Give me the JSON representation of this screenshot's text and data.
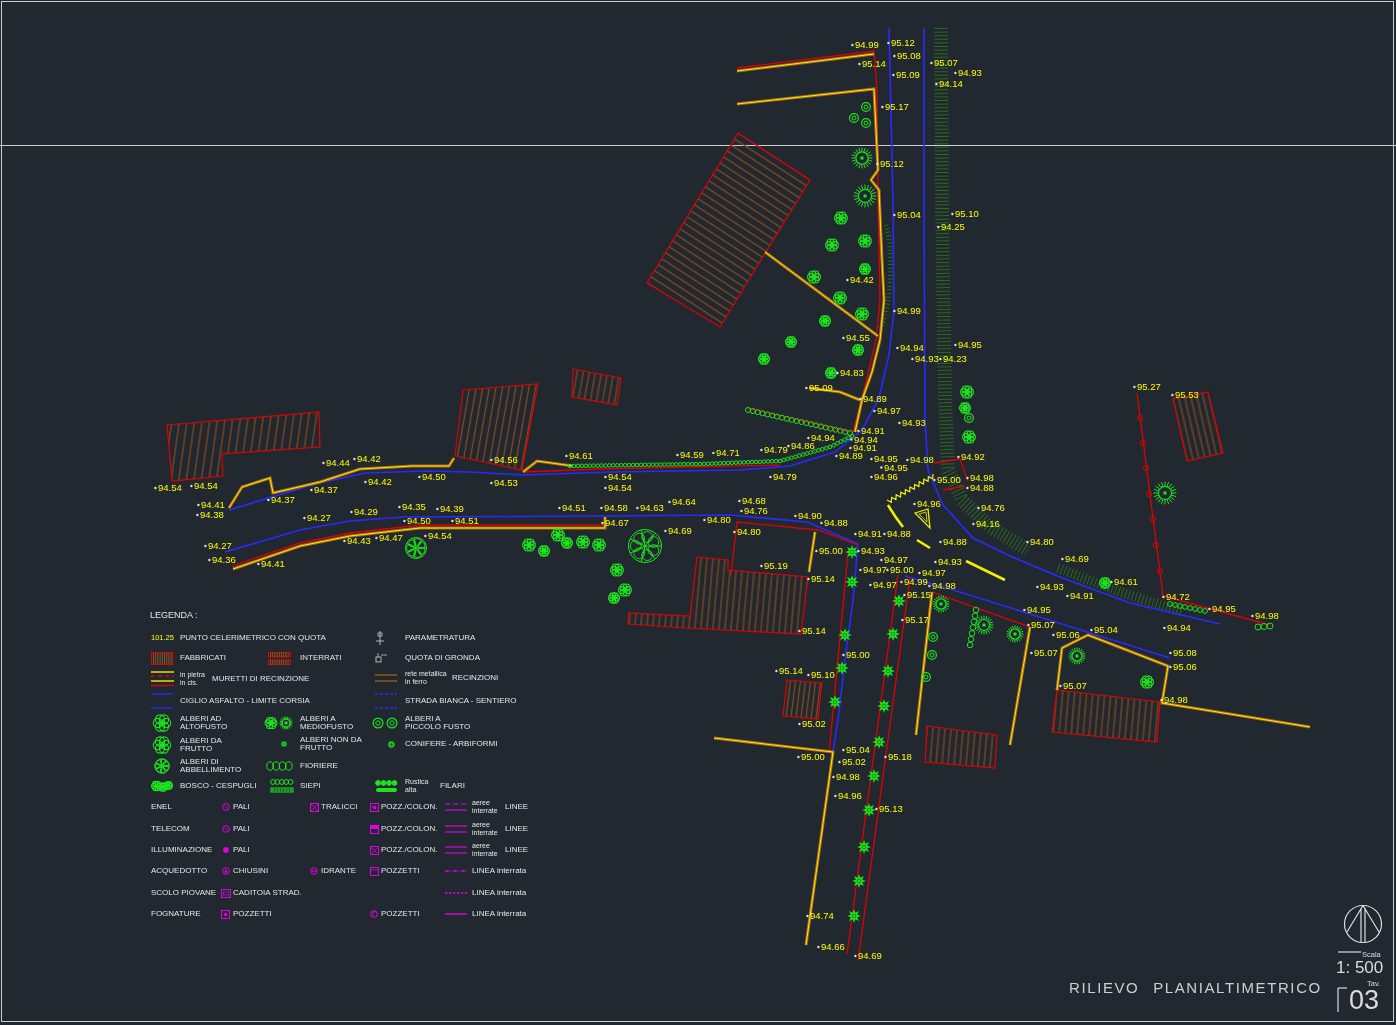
{
  "drawing": {
    "spot_heights": [
      "94.99",
      "95.12",
      "95.08",
      "95.14",
      "95.09",
      "95.07",
      "94.93",
      "94.14",
      "95.17",
      "95.12",
      "95.04",
      "95.10",
      "94.25",
      "94.42",
      "94.99",
      "94.55",
      "94.94",
      "94.95",
      "94.93",
      "94.23",
      "94.83",
      "95.09",
      "94.89",
      "94.97",
      "94.93",
      "94.91",
      "94.94",
      "94.94",
      "94.79",
      "94.86",
      "94.91",
      "94.89",
      "94.95",
      "94.98",
      "94.92",
      "94.95",
      "94.79",
      "94.96",
      "95.00",
      "94.98",
      "94.88",
      "94.96",
      "94.76",
      "94.16",
      "94.88",
      "94.80",
      "94.54",
      "94.54",
      "94.44",
      "94.42",
      "94.37",
      "94.37",
      "94.42",
      "94.50",
      "94.56",
      "94.53",
      "94.61",
      "94.59",
      "94.71",
      "94.54",
      "94.54",
      "94.41",
      "94.38",
      "94.27",
      "94.29",
      "94.35",
      "94.39",
      "94.50",
      "94.51",
      "94.43",
      "94.47",
      "94.54",
      "94.51",
      "94.58",
      "94.63",
      "94.64",
      "94.67",
      "94.69",
      "94.27",
      "94.36",
      "94.41",
      "94.80",
      "94.68",
      "94.76",
      "94.80",
      "94.90",
      "94.88",
      "94.91",
      "94.88",
      "95.00",
      "94.93",
      "94.97",
      "94.93",
      "94.97",
      "95.00",
      "94.97",
      "94.99",
      "94.97",
      "94.98",
      "95.15",
      "95.19",
      "95.14",
      "95.14",
      "95.17",
      "95.00",
      "95.14",
      "95.10",
      "95.02",
      "95.04",
      "95.00",
      "95.02",
      "95.18",
      "94.98",
      "94.96",
      "95.13",
      "94.74",
      "94.66",
      "94.69",
      "95.27",
      "95.53",
      "94.69",
      "94.61",
      "94.93",
      "94.91",
      "94.72",
      "94.95",
      "94.98",
      "94.95",
      "95.07",
      "95.04",
      "94.94",
      "95.06",
      "95.07",
      "95.08",
      "95.06",
      "95.07",
      "94.98"
    ]
  },
  "legend": {
    "heading": "LEGENDA :",
    "entries": [
      {
        "kind": "spot",
        "sample": "101.25",
        "label": "PUNTO CELERIMETRICO CON QUOTA"
      },
      {
        "kind": "parametratura",
        "label": "PARAMETRATURA"
      },
      {
        "kind": "building",
        "label": "FABBRICATI"
      },
      {
        "kind": "underground",
        "label": "INTERRATI"
      },
      {
        "kind": "eaves",
        "label": "QUOTA DI GRONDA"
      },
      {
        "kind": "wall",
        "notes": [
          "in pietra",
          "in cls."
        ],
        "label": "MURETTI DI RECINZIONE"
      },
      {
        "kind": "fence",
        "notes": [
          "rete metallica",
          "in ferro"
        ],
        "label": "RECINZIONI"
      },
      {
        "kind": "asphalt",
        "label": "CIGLIO ASFALTO - LIMITE CORSIA"
      },
      {
        "kind": "dirt-road",
        "label": "STRADA BIANCA - SENTIERO"
      },
      {
        "kind": "tree-tall",
        "label": "ALBERI AD\nALTOFUSTO"
      },
      {
        "kind": "tree-medium",
        "label": "ALBERI A\nMEDIOFUSTO"
      },
      {
        "kind": "tree-small",
        "label": "ALBERI A\nPICCOLO FUSTO"
      },
      {
        "kind": "tree-fruit",
        "label": "ALBERI DA\nFRUTTO"
      },
      {
        "kind": "tree-nonfruit",
        "label": "ALBERI NON DA\nFRUTTO"
      },
      {
        "kind": "conifer",
        "label": "CONIFERE - ARBIFORMI"
      },
      {
        "kind": "tree-ornamental",
        "label": "ALBERI DI\nABBELLIMENTO"
      },
      {
        "kind": "planter",
        "label": "FIORIERE"
      },
      {
        "kind": "woods",
        "label": "BOSCO - CESPUGLI"
      },
      {
        "kind": "hedge",
        "label": "SIEPI"
      },
      {
        "kind": "tree-row",
        "notes": [
          "Rustica",
          "alta"
        ],
        "label": "FILARI"
      },
      {
        "kind": "text",
        "label": "ENEL"
      },
      {
        "kind": "pole",
        "label": "PALI"
      },
      {
        "kind": "pylon",
        "label": "TRALICCI"
      },
      {
        "kind": "manhole",
        "label": "POZZ./COLON."
      },
      {
        "kind": "line-aerial",
        "notes": [
          "aeree",
          "interrate"
        ],
        "label": "LINEE"
      },
      {
        "kind": "text",
        "label": "TELECOM"
      },
      {
        "kind": "pole",
        "label": "PALI"
      },
      {
        "kind": "manhole-box",
        "label": "POZZ./COLON."
      },
      {
        "kind": "line-double",
        "notes": [
          "aeree",
          "interrate"
        ],
        "label": "LINEE"
      },
      {
        "kind": "text",
        "label": "ILLUMINAZIONE"
      },
      {
        "kind": "pole-dot",
        "label": "PALI"
      },
      {
        "kind": "manhole-x",
        "label": "POZZ./COLON."
      },
      {
        "kind": "line-double",
        "notes": [
          "aeree",
          "interrate"
        ],
        "label": "LINEE"
      },
      {
        "kind": "text",
        "label": "ACQUEDOTTO"
      },
      {
        "kind": "valve",
        "label": "CHIUSINI"
      },
      {
        "kind": "hydrant",
        "label": "IDRANTE"
      },
      {
        "kind": "manhole-pit",
        "label": "POZZETTI"
      },
      {
        "kind": "line-dashdot",
        "label": "LINEA interrata"
      },
      {
        "kind": "text",
        "label": "SCOLO PIOVANE"
      },
      {
        "kind": "drain",
        "label": "CADITOIA STRAD."
      },
      {
        "kind": "line-dashed",
        "label": "LINEA interrata"
      },
      {
        "kind": "text",
        "label": "FOGNATURE"
      },
      {
        "kind": "manhole",
        "label": "POZZETTI"
      },
      {
        "kind": "sewer-round",
        "label": "POZZETTI"
      },
      {
        "kind": "line-solid",
        "label": "LINEA interrata"
      }
    ]
  },
  "title_block": {
    "title": "RILIEVO PLANIALTIMETRICO",
    "scale_label": "Scala",
    "scale": "1: 500",
    "sheet_label": "Tav.",
    "sheet": "03"
  }
}
